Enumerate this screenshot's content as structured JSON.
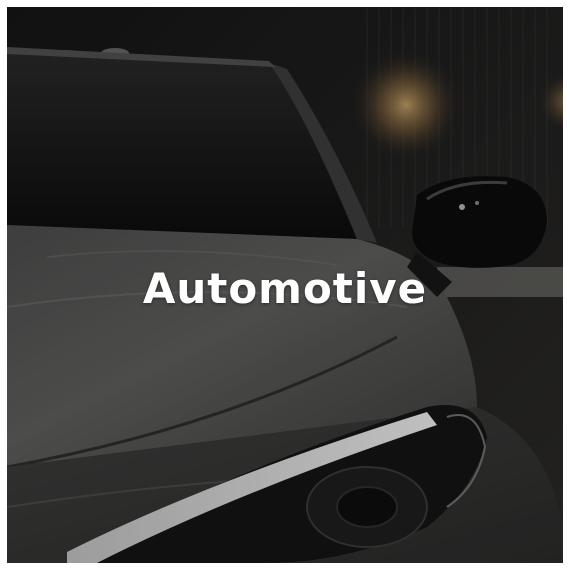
{
  "tile": {
    "title": "Automotive",
    "image": "car-front-photo"
  }
}
